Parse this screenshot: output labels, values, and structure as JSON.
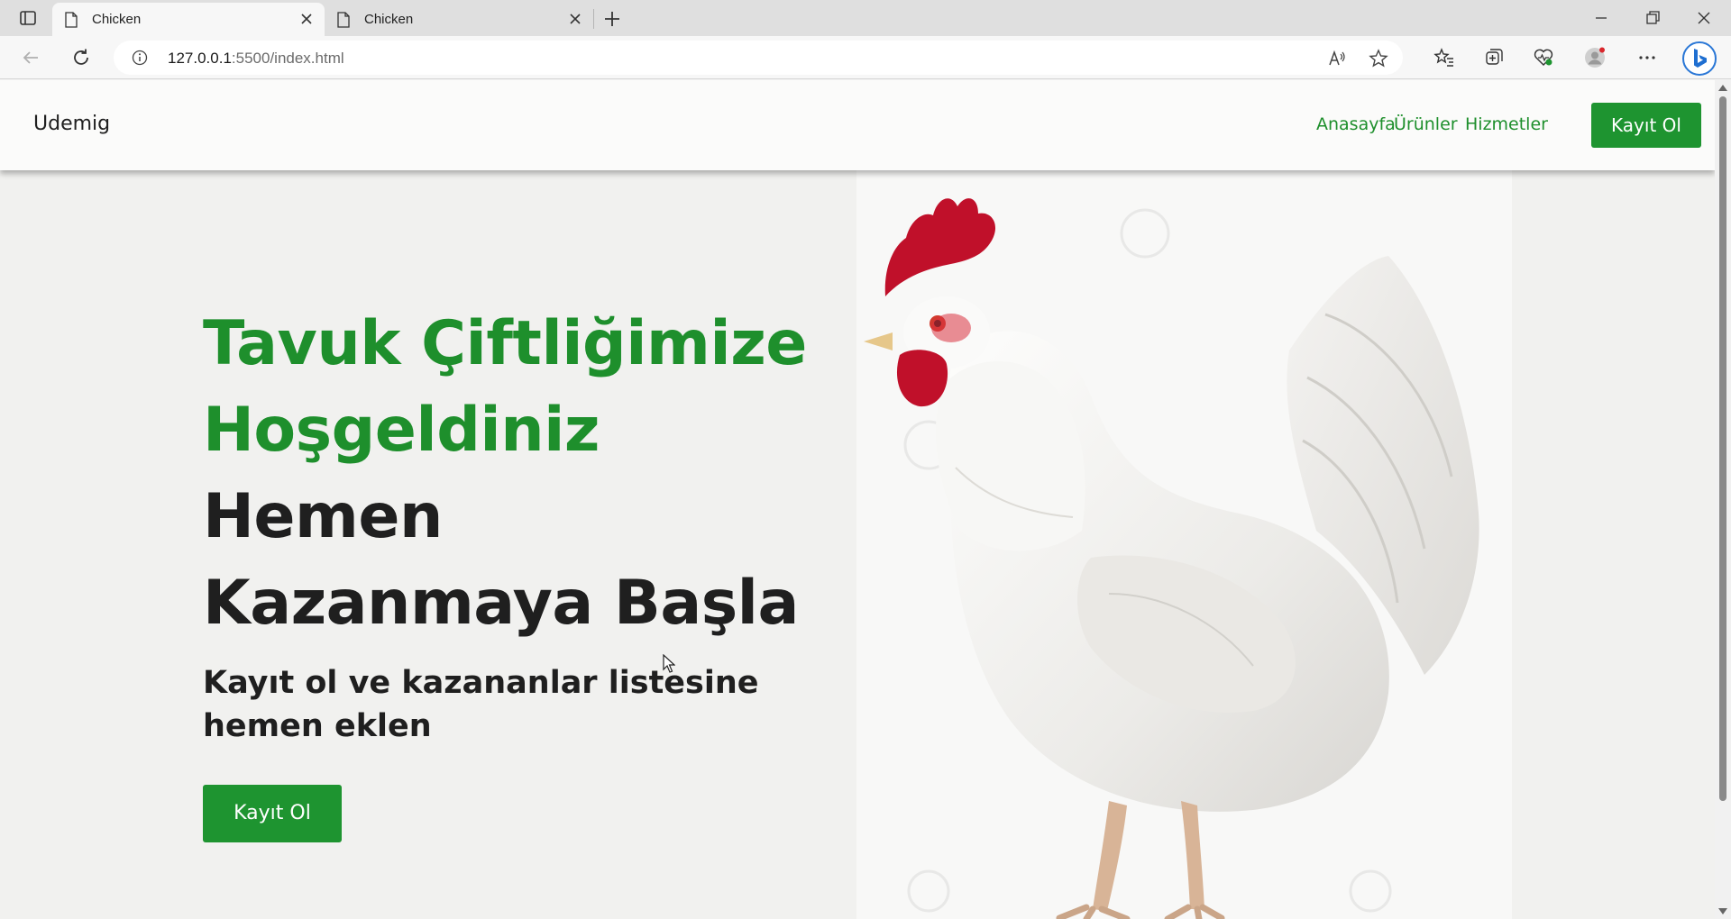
{
  "browser": {
    "tabs": [
      {
        "title": "Chicken",
        "active": true
      },
      {
        "title": "Chicken",
        "active": false
      }
    ],
    "url": {
      "host": "127.0.0.1",
      "rest": ":5500/index.html"
    }
  },
  "site": {
    "logo": "Udemig",
    "nav": [
      "Anasayfa",
      "Ürünler",
      "Hizmetler"
    ],
    "header_cta": "Kayıt Ol",
    "hero": {
      "title_green": [
        "Tavuk Çiftliğimize",
        "Hoşgeldiniz"
      ],
      "title_dark": [
        "Hemen",
        "Kazanmaya Başla"
      ],
      "subtitle": "Kayıt ol ve kazananlar listesine hemen eklen",
      "cta": "Kayıt Ol"
    }
  },
  "colors": {
    "brand_green": "#1e9430",
    "text_dark": "#1f1f1f"
  }
}
